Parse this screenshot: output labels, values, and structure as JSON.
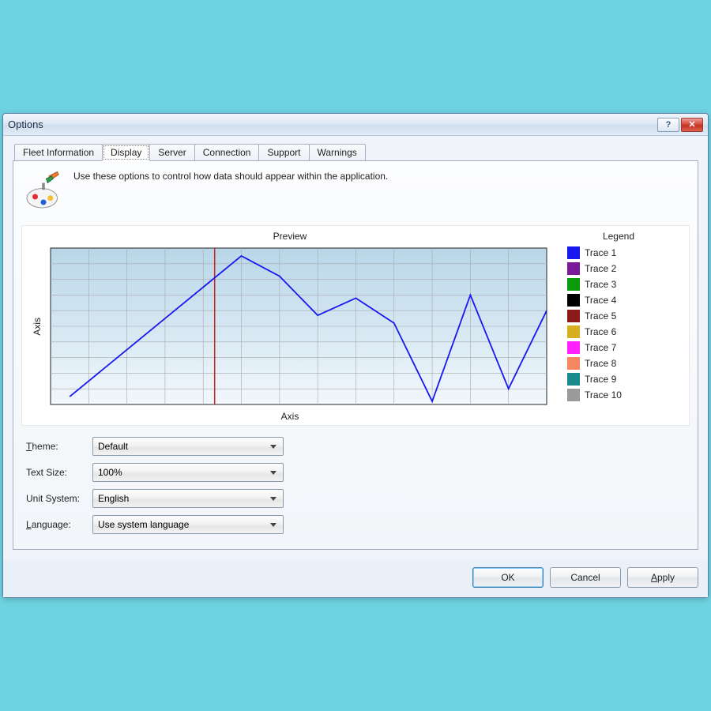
{
  "window": {
    "title": "Options",
    "help_tooltip": "?",
    "close_tooltip": "✕"
  },
  "tabs": [
    {
      "label": "Fleet Information",
      "active": false
    },
    {
      "label": "Display",
      "active": true
    },
    {
      "label": "Server",
      "active": false
    },
    {
      "label": "Connection",
      "active": false
    },
    {
      "label": "Support",
      "active": false
    },
    {
      "label": "Warnings",
      "active": false
    }
  ],
  "description": "Use these options to control how data should appear within the application.",
  "preview": {
    "title": "Preview",
    "axis_label": "Axis",
    "legend_title": "Legend",
    "traces": [
      {
        "label": "Trace 1",
        "color": "#1818f0"
      },
      {
        "label": "Trace 2",
        "color": "#7a1a9a"
      },
      {
        "label": "Trace 3",
        "color": "#0a9a0a"
      },
      {
        "label": "Trace 4",
        "color": "#000000"
      },
      {
        "label": "Trace 5",
        "color": "#8a1a1a"
      },
      {
        "label": "Trace 6",
        "color": "#d6b020"
      },
      {
        "label": "Trace 7",
        "color": "#ff20ff"
      },
      {
        "label": "Trace 8",
        "color": "#f58860"
      },
      {
        "label": "Trace 9",
        "color": "#1a8a8a"
      },
      {
        "label": "Trace 10",
        "color": "#9a9a9a"
      }
    ]
  },
  "chart_data": {
    "type": "line",
    "title": "Preview",
    "xlabel": "Axis",
    "ylabel": "Axis",
    "xlim": [
      0,
      13
    ],
    "ylim": [
      0,
      10
    ],
    "cursor_x": 4.3,
    "series": [
      {
        "name": "Trace 1",
        "color": "#1818f0",
        "x": [
          0.5,
          1,
          2,
          3,
          4,
          5,
          6,
          7,
          8,
          9,
          10,
          11,
          12,
          13
        ],
        "y": [
          0.5,
          1.5,
          3.5,
          5.5,
          7.5,
          9.5,
          8.2,
          5.7,
          6.8,
          5.2,
          0.2,
          7.0,
          1.0,
          6.0
        ]
      }
    ],
    "grid": true
  },
  "fields": {
    "theme": {
      "label": "Theme:",
      "value": "Default",
      "underline": "T"
    },
    "text_size": {
      "label": "Text Size:",
      "value": "100%"
    },
    "unit_system": {
      "label": "Unit System:",
      "value": "English"
    },
    "language": {
      "label": "Language:",
      "value": "Use system language",
      "underline": "L"
    }
  },
  "buttons": {
    "ok": "OK",
    "cancel": "Cancel",
    "apply": "Apply"
  }
}
